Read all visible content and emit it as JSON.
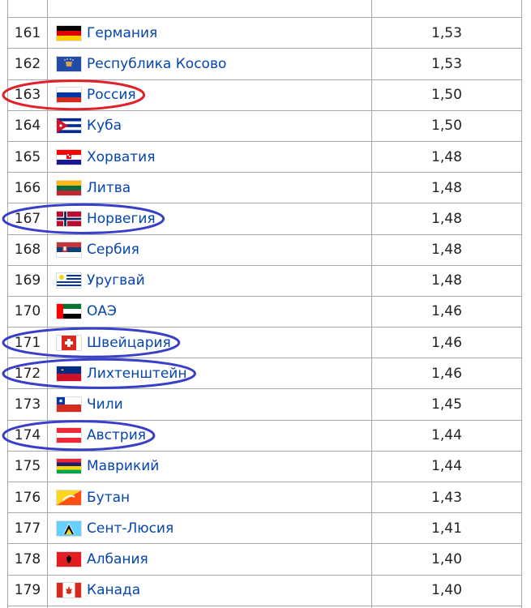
{
  "table": {
    "rows": [
      {
        "rank": "",
        "country": "",
        "value": "",
        "flag": "none"
      },
      {
        "rank": "161",
        "country": "Германия",
        "value": "1,53",
        "flag": "germany-flag-icon"
      },
      {
        "rank": "162",
        "country": "Республика Косово",
        "value": "1,53",
        "flag": "kosovo-flag-icon"
      },
      {
        "rank": "163",
        "country": "Россия",
        "value": "1,50",
        "flag": "russia-flag-icon"
      },
      {
        "rank": "164",
        "country": "Куба",
        "value": "1,50",
        "flag": "cuba-flag-icon"
      },
      {
        "rank": "165",
        "country": "Хорватия",
        "value": "1,48",
        "flag": "croatia-flag-icon"
      },
      {
        "rank": "166",
        "country": "Литва",
        "value": "1,48",
        "flag": "lithuania-flag-icon"
      },
      {
        "rank": "167",
        "country": "Норвегия",
        "value": "1,48",
        "flag": "norway-flag-icon"
      },
      {
        "rank": "168",
        "country": "Сербия",
        "value": "1,48",
        "flag": "serbia-flag-icon"
      },
      {
        "rank": "169",
        "country": "Уругвай",
        "value": "1,48",
        "flag": "uruguay-flag-icon"
      },
      {
        "rank": "170",
        "country": "ОАЭ",
        "value": "1,46",
        "flag": "uae-flag-icon"
      },
      {
        "rank": "171",
        "country": "Швейцария",
        "value": "1,46",
        "flag": "switzerland-flag-icon"
      },
      {
        "rank": "172",
        "country": "Лихтенштейн",
        "value": "1,46",
        "flag": "liechtenstein-flag-icon"
      },
      {
        "rank": "173",
        "country": "Чили",
        "value": "1,45",
        "flag": "chile-flag-icon"
      },
      {
        "rank": "174",
        "country": "Австрия",
        "value": "1,44",
        "flag": "austria-flag-icon"
      },
      {
        "rank": "175",
        "country": "Маврикий",
        "value": "1,44",
        "flag": "mauritius-flag-icon"
      },
      {
        "rank": "176",
        "country": "Бутан",
        "value": "1,43",
        "flag": "bhutan-flag-icon"
      },
      {
        "rank": "177",
        "country": "Сент-Люсия",
        "value": "1,41",
        "flag": "saint-lucia-flag-icon"
      },
      {
        "rank": "178",
        "country": "Албания",
        "value": "1,40",
        "flag": "albania-flag-icon"
      },
      {
        "rank": "179",
        "country": "Канада",
        "value": "1,40",
        "flag": "canada-flag-icon"
      },
      {
        "rank": "",
        "country": "",
        "value": "",
        "flag": "none"
      }
    ]
  },
  "highlights": {
    "red_color": "#e0202a",
    "blue_color": "#3a3fc8",
    "red_ranks": [
      "163"
    ],
    "blue_ranks": [
      "167",
      "171",
      "172",
      "174"
    ]
  },
  "colors": {
    "link": "#0645ad",
    "border": "#a2a9b1",
    "text": "#222222"
  }
}
